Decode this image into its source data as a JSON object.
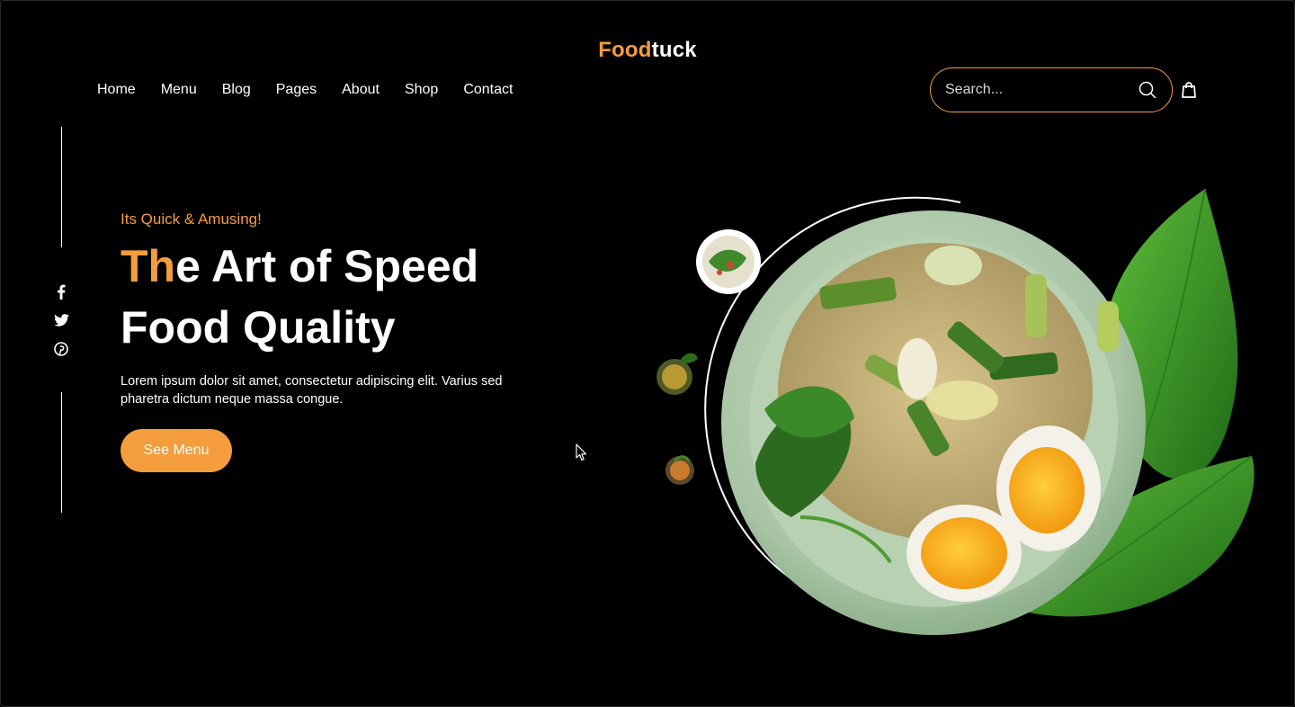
{
  "brand": {
    "logo_accent": "Food",
    "logo_rest": "tuck",
    "accent_color": "#f39d3c"
  },
  "nav": {
    "items": [
      "Home",
      "Menu",
      "Blog",
      "Pages",
      "About",
      "Shop",
      "Contact"
    ]
  },
  "search": {
    "placeholder": "Search..."
  },
  "social": {
    "icons": [
      "facebook-icon",
      "twitter-icon",
      "pinterest-icon"
    ]
  },
  "hero": {
    "tagline": "Its Quick & Amusing!",
    "headline_highlight": "Th",
    "headline_rest_line1": "e Art of Speed",
    "headline_line2": "Food Quality",
    "description": "Lorem ipsum dolor sit amet, consectetur adipiscing elit. Varius sed pharetra dictum neque massa congue.",
    "cta_label": "See Menu"
  }
}
